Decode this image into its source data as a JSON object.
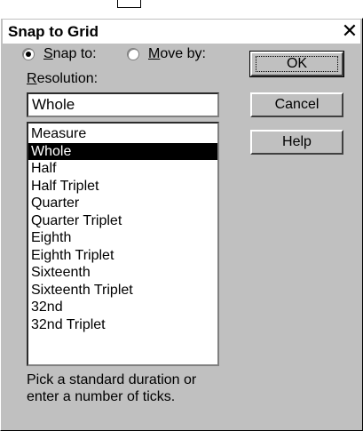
{
  "dialog": {
    "title": "Snap to Grid",
    "close_symbol": "✕"
  },
  "options": {
    "snap_to_first": "S",
    "snap_to_rest": "nap to:",
    "move_by_first": "M",
    "move_by_rest": "ove by:",
    "selected": "snap_to"
  },
  "resolution": {
    "label_first": "R",
    "label_rest": "esolution:",
    "value": "Whole",
    "items": [
      "Measure",
      "Whole",
      "Half",
      "Half Triplet",
      "Quarter",
      "Quarter Triplet",
      "Eighth",
      "Eighth Triplet",
      "Sixteenth",
      "Sixteenth Triplet",
      "32nd",
      "32nd Triplet"
    ],
    "selected_index": 1
  },
  "hint": "Pick a standard duration or enter a number of ticks.",
  "buttons": {
    "ok": "OK",
    "cancel": "Cancel",
    "help": "Help"
  }
}
